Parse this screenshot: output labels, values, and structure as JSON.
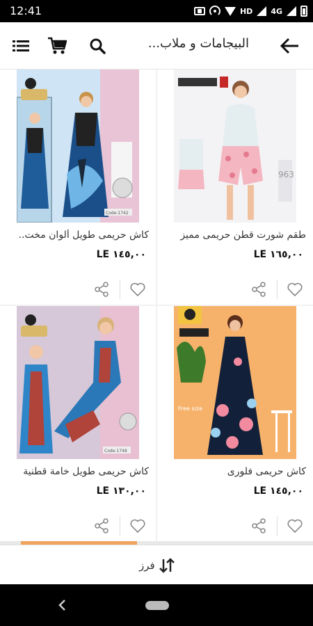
{
  "status_bar": {
    "time": "12:41",
    "hd_label": "HD",
    "network_label": "4G"
  },
  "app_bar": {
    "title": "البيجامات و ملاب...",
    "icons": [
      "list-menu-icon",
      "cart-icon",
      "search-icon",
      "back-arrow-icon"
    ]
  },
  "products": [
    {
      "title": "طقم شورت قطن حريمى مميز",
      "price": "LE ١٦٥,٠٠",
      "image": "model in white top and pink floral shorts"
    },
    {
      "title": "كاش حريمى طويل ألوان مخت..",
      "price": "LE ١٤٥,٠٠",
      "image": "long blue floral nightgown"
    },
    {
      "title": "كاش حريمى فلورى",
      "price": "LE ١٤٥,٠٠",
      "image": "navy floral long nightgown"
    },
    {
      "title": "كاش حريمى طويل خامة قطنية",
      "price": "LE ١٣٠,٠٠",
      "image": "blue patterned long nightgown"
    }
  ],
  "actions": {
    "share_icon": "share-icon",
    "favorite_icon": "heart-icon"
  },
  "scroll_progress": 0.37,
  "sort_bar": {
    "label": "فرز"
  },
  "colors": {
    "accent": "#f0a35c",
    "text": "#222222"
  }
}
